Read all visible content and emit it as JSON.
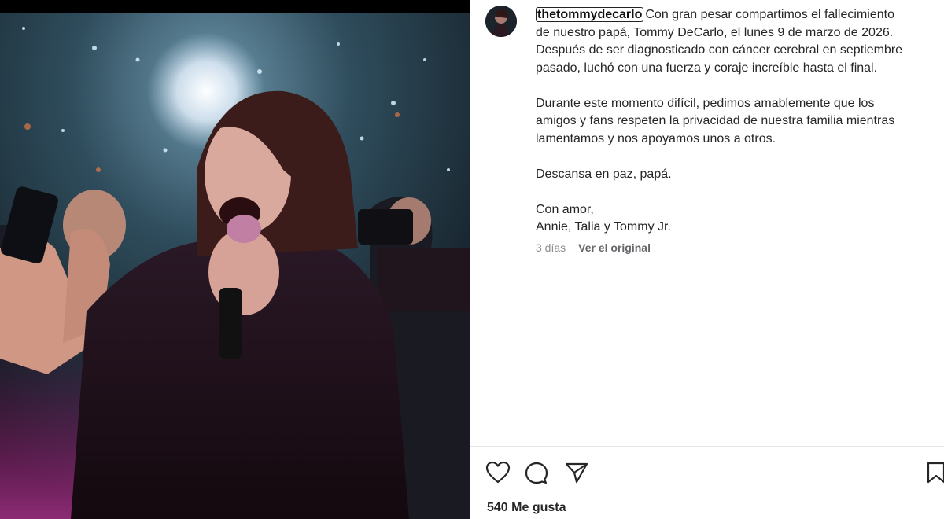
{
  "post": {
    "username": "thetommydecarlo",
    "caption_lines": [
      "Con gran pesar compartimos el fallecimiento",
      "de nuestro papá, Tommy DeCarlo, el lunes 9 de marzo de 2026.",
      "Después de ser diagnosticado con cáncer cerebral en septiembre",
      "pasado, luchó con una fuerza y coraje increíble hasta el final.",
      "",
      "Durante este momento difícil, pedimos amablemente que los",
      "amigos y fans respeten la privacidad de nuestra familia mientras",
      "lamentamos y nos apoyamos unos a otros.",
      "",
      "Descansa en paz, papá.",
      "",
      "Con amor,",
      "Annie, Talia y Tommy Jr."
    ],
    "time_ago": "3 días",
    "see_original": "Ver el original",
    "likes_text": "540 Me gusta"
  },
  "icons": {
    "like": "heart-icon",
    "comment": "comment-icon",
    "share": "send-icon",
    "save": "bookmark-icon"
  },
  "colors": {
    "text": "#262626",
    "secondary_text": "#8e8e8e",
    "divider": "#e6e6e6"
  }
}
